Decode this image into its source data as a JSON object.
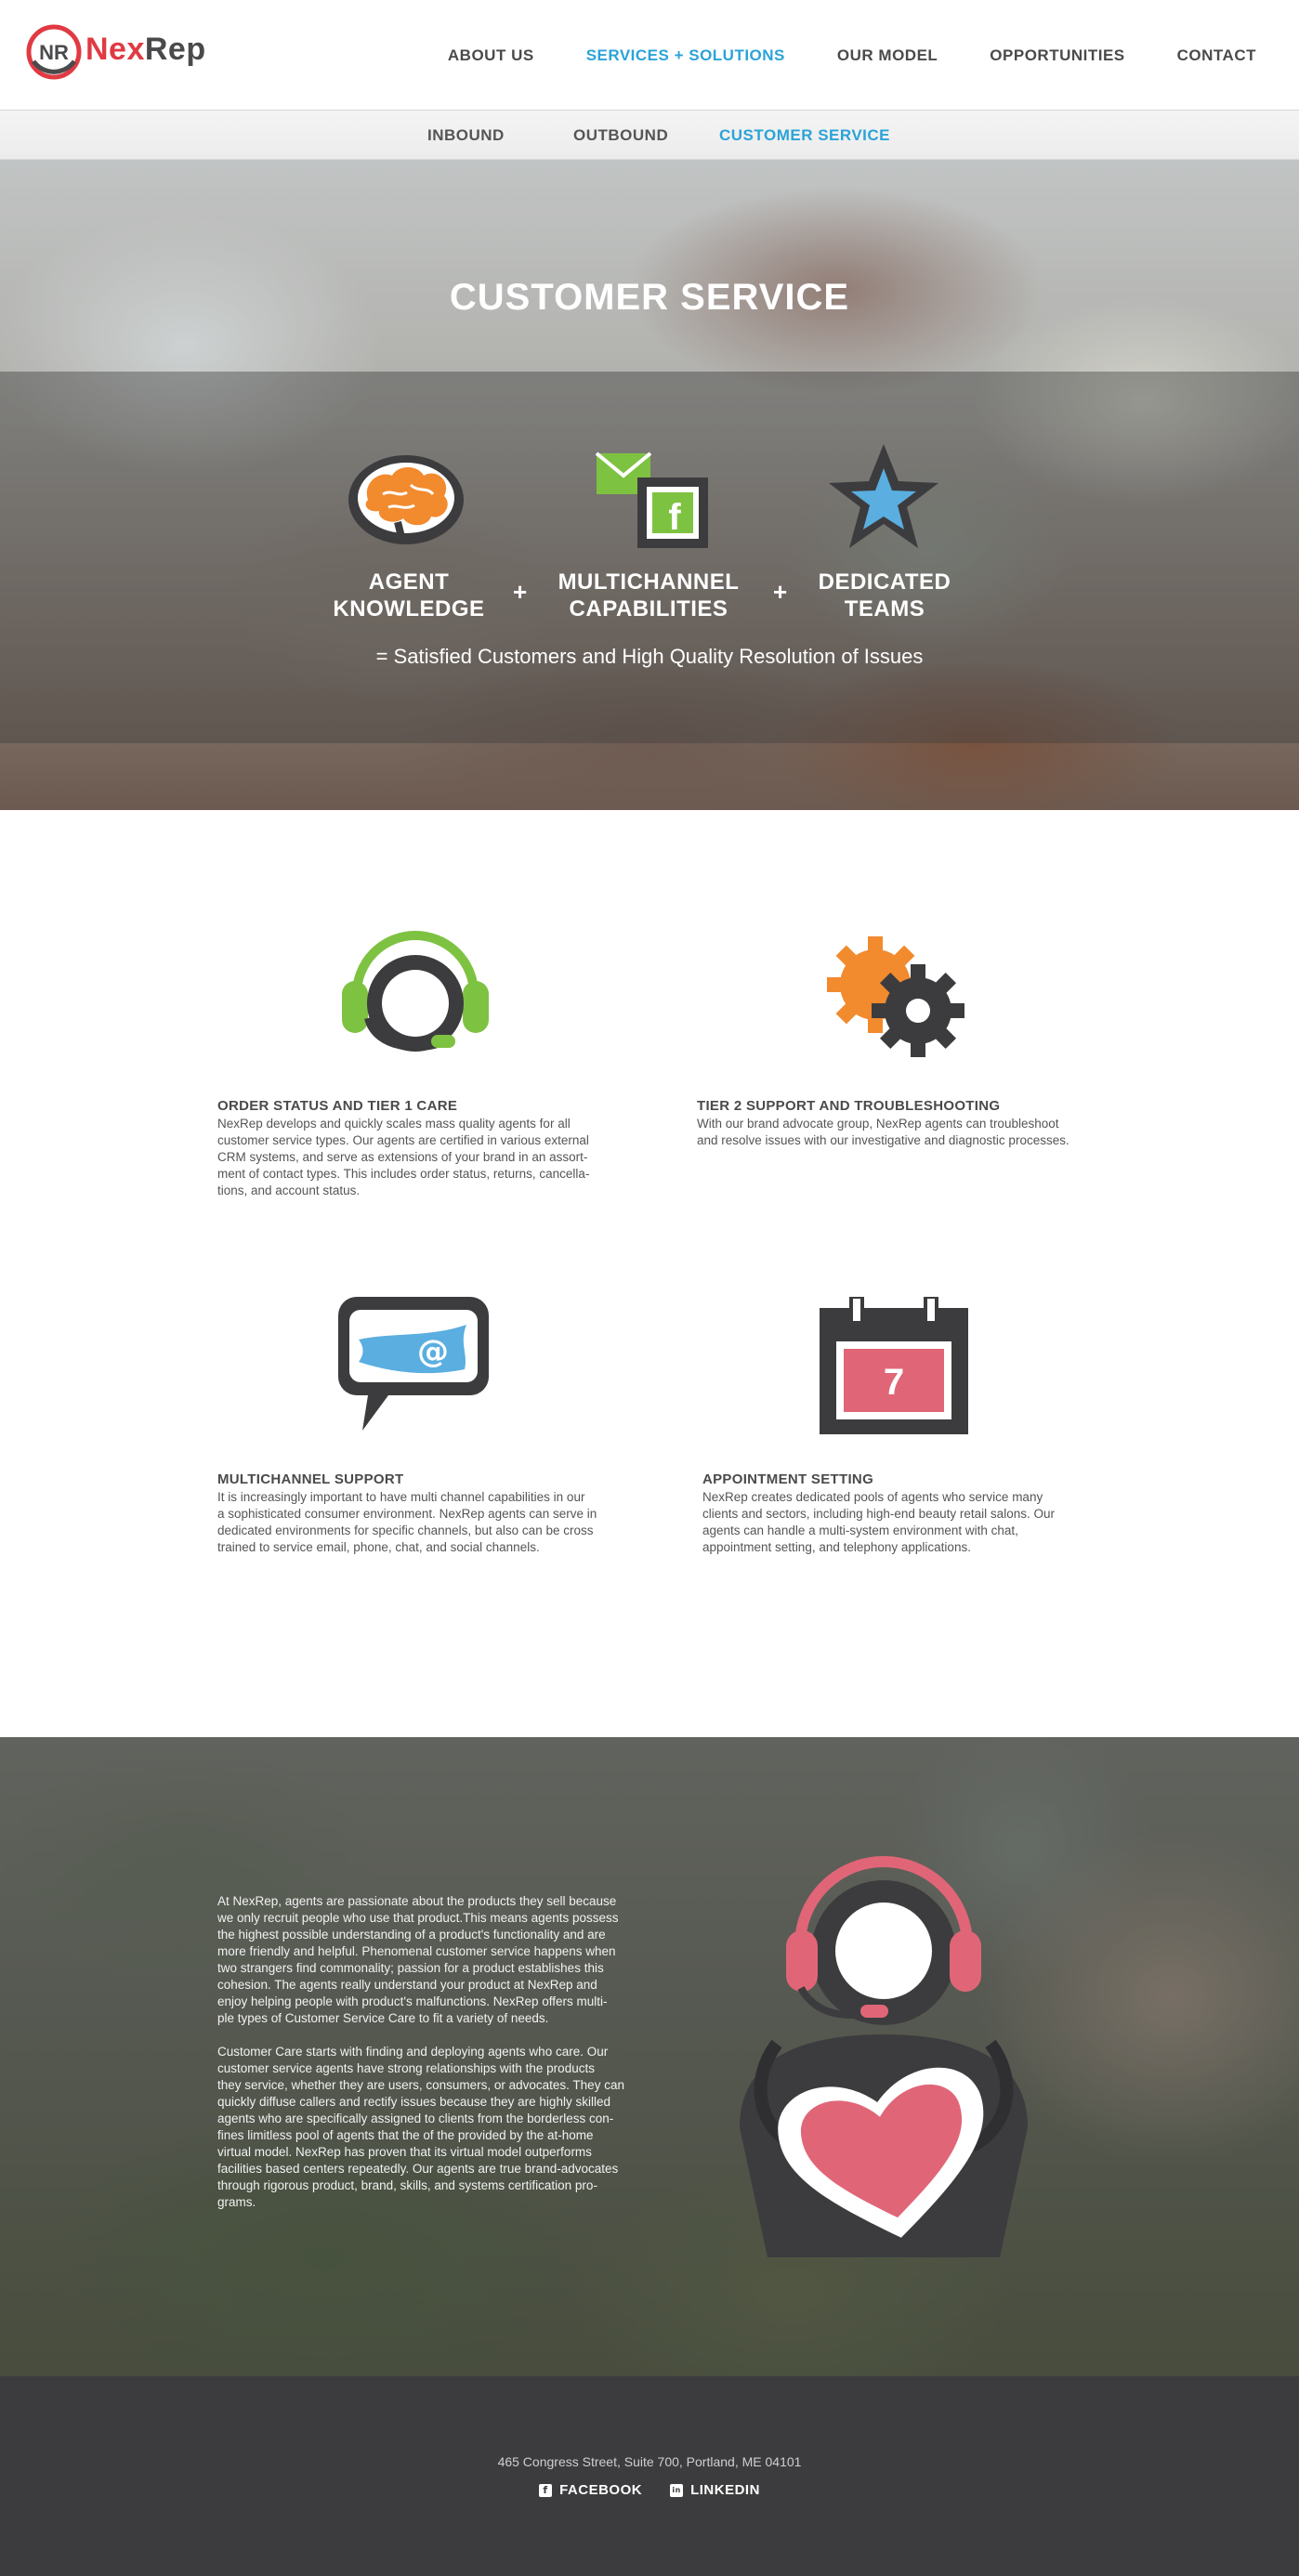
{
  "brand": {
    "name_part1": "Nex",
    "name_part2": "Rep",
    "monogram": "NR"
  },
  "nav": {
    "items": [
      {
        "label": "ABOUT US",
        "active": false
      },
      {
        "label": "SERVICES + SOLUTIONS",
        "active": true
      },
      {
        "label": "OUR MODEL",
        "active": false
      },
      {
        "label": "OPPORTUNITIES",
        "active": false
      },
      {
        "label": "CONTACT",
        "active": false
      }
    ]
  },
  "subnav": {
    "items": [
      {
        "label": "INBOUND",
        "active": false
      },
      {
        "label": "OUTBOUND",
        "active": false
      },
      {
        "label": "CUSTOMER SERVICE",
        "active": true
      }
    ]
  },
  "hero": {
    "title": "CUSTOMER SERVICE",
    "pillars": [
      {
        "line1": "AGENT",
        "line2": "KNOWLEDGE",
        "icon": "brain-icon"
      },
      {
        "line1": "MULTICHANNEL",
        "line2": "CAPABILITIES",
        "icon": "email-facebook-icon"
      },
      {
        "line1": "DEDICATED",
        "line2": "TEAMS",
        "icon": "star-icon"
      }
    ],
    "plus": "+",
    "tagline": "= Satisfied Customers and High Quality Resolution of Issues"
  },
  "services": [
    {
      "title": "ORDER STATUS AND TIER 1 CARE",
      "icon": "headset-icon",
      "lines": [
        "NexRep develops and quickly scales mass quality agents for all",
        "customer service types. Our agents are certified in various external",
        "CRM systems, and serve as extensions of your brand in an assort-",
        "ment of contact types. This includes order status, returns, cancella-",
        "tions, and account status."
      ]
    },
    {
      "title": "TIER 2 SUPPORT AND TROUBLESHOOTING",
      "icon": "gears-icon",
      "lines": [
        "With our brand advocate group, NexRep agents can troubleshoot",
        "and resolve issues with our investigative and diagnostic processes."
      ]
    },
    {
      "title": "MULTICHANNEL SUPPORT",
      "icon": "chat-email-icon",
      "lines": [
        "It is increasingly important to have multi channel capabilities in our",
        "a sophisticated consumer environment. NexRep agents can serve in",
        "dedicated environments for specific channels, but also can be cross",
        "trained to service email, phone, chat, and social channels."
      ]
    },
    {
      "title": "APPOINTMENT SETTING",
      "icon": "calendar-icon",
      "calendar_day": "7",
      "lines": [
        "NexRep creates dedicated pools of agents who service many",
        "clients and sectors, including high-end beauty retail salons. Our",
        "agents can handle a multi-system environment with chat,",
        "appointment setting, and telephony applications."
      ]
    }
  ],
  "story": {
    "paragraph1": [
      "At NexRep, agents are passionate about the products they sell because",
      "we only recruit people who use that product.This means agents possess",
      "the highest possible understanding of a product's functionality and are",
      "more friendly and helpful. Phenomenal customer service happens when",
      "two strangers find commonality; passion for a product establishes this",
      "cohesion. The agents really understand your product at NexRep and",
      "enjoy helping people with product's malfunctions. NexRep offers multi-",
      "ple types of Customer Service Care to fit a variety of needs."
    ],
    "paragraph2": [
      "Customer Care starts with finding and deploying agents who care. Our",
      "customer service agents have strong relationships with the products",
      "they service, whether they are users, consumers, or advocates. They can",
      "quickly diffuse callers and rectify issues because they are highly skilled",
      "agents who are specifically assigned to clients from the borderless con-",
      "fines limitless pool of agents that the of the provided by the at-home",
      "virtual model. NexRep has proven that its virtual model outperforms",
      "facilities based centers repeatedly. Our agents are true brand-advocates",
      "through rigorous product, brand, skills, and systems certification pro-",
      "grams."
    ],
    "illustration": "agent-heart-icon"
  },
  "footer": {
    "address": "465 Congress Street, Suite 700, Portland, ME 04101",
    "links": [
      {
        "label": "FACEBOOK",
        "icon": "facebook-icon",
        "glyph": "f"
      },
      {
        "label": "LINKEDIN",
        "icon": "linkedin-icon",
        "glyph": "in"
      }
    ]
  },
  "colors": {
    "brand_red": "#e03a43",
    "active_blue": "#2ba3d7",
    "dark_gray": "#4a4a4c",
    "green": "#7ec242",
    "orange": "#f28a2e",
    "pink": "#e06677",
    "light_blue": "#5aaee0",
    "footer_bg": "#3c3c3e"
  }
}
